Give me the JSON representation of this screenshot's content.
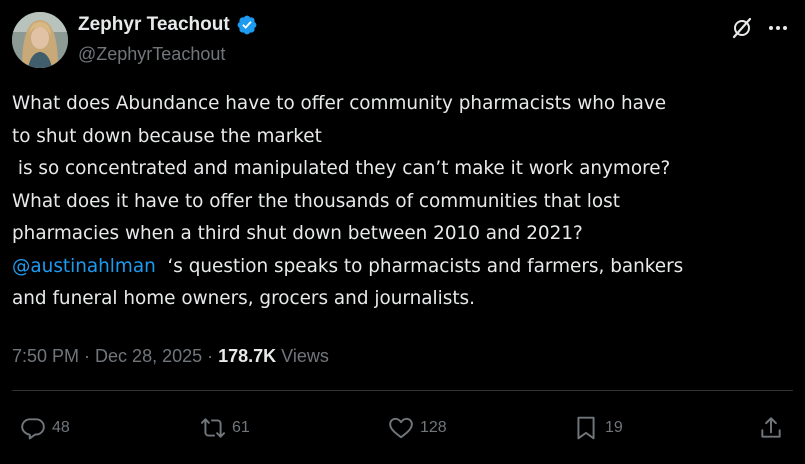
{
  "author": {
    "display_name": "Zephyr Teachout",
    "handle": "@ZephyrTeachout",
    "verified": true
  },
  "icons": {
    "avatar": "user-avatar-photo",
    "verified": "verified-badge-icon",
    "grok": "grok-icon",
    "more": "more-options-icon",
    "reply": "reply-icon",
    "repost": "repost-icon",
    "like": "like-icon",
    "bookmark": "bookmark-icon",
    "share": "share-icon"
  },
  "tweet": {
    "lines": [
      "What does Abundance have to offer community pharmacists who have",
      "to shut down because the market",
      " is so concentrated and manipulated they can’t make it work anymore?",
      "What does it have to offer the thousands of communities that lost",
      "pharmacies when a third shut down between 2010 and 2021?"
    ],
    "mention": "@austinahlman",
    "after_mention": "  ‘s question speaks to pharmacists and farmers, bankers",
    "last_line": "and funeral home owners, grocers and journalists."
  },
  "meta": {
    "time": "7:50 PM",
    "separator": " · ",
    "date": "Dec 28, 2025",
    "views_count": "178.7K",
    "views_label": " Views"
  },
  "actions": {
    "replies": "48",
    "reposts": "61",
    "likes": "128",
    "bookmarks": "19"
  },
  "colors": {
    "background": "#000000",
    "text": "#e7e9ea",
    "secondary": "#71767b",
    "accent": "#1d9bf0",
    "divider": "#2f3336"
  }
}
